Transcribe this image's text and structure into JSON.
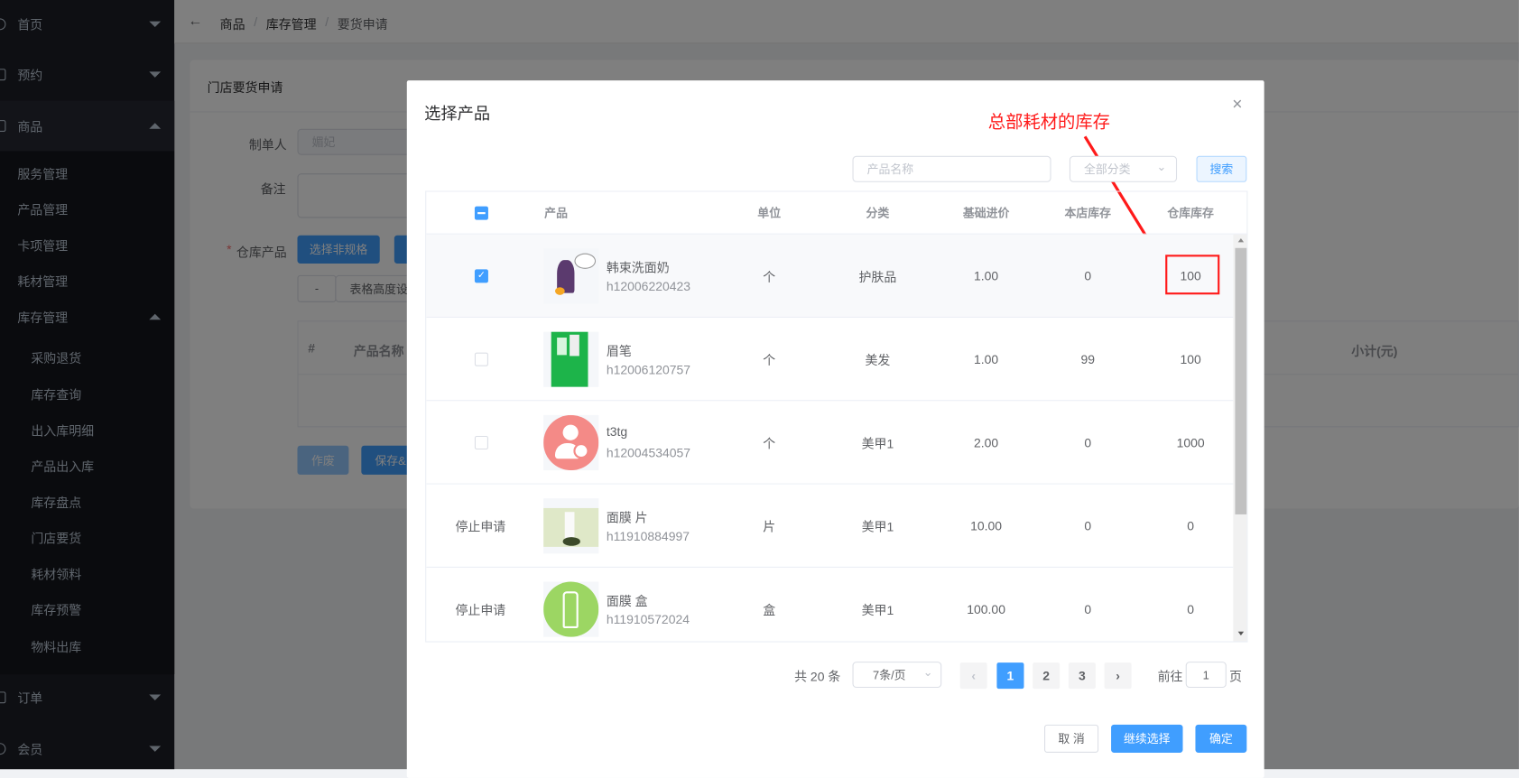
{
  "sidebar": {
    "items": [
      {
        "label": "首页"
      },
      {
        "label": "预约"
      },
      {
        "label": "商品"
      }
    ],
    "goods_sub": [
      "服务管理",
      "产品管理",
      "卡项管理",
      "耗材管理"
    ],
    "inventory": {
      "label": "库存管理",
      "sub": [
        "采购退货",
        "库存查询",
        "出入库明细",
        "产品出入库",
        "库存盘点",
        "门店要货",
        "耗材领料",
        "库存预警",
        "物料出库"
      ]
    },
    "bottom": [
      {
        "label": "订单"
      },
      {
        "label": "会员"
      }
    ]
  },
  "breadcrumb": {
    "back": "←",
    "items": [
      "商品",
      "库存管理",
      "要货申请"
    ],
    "sep": "/"
  },
  "form": {
    "card_title": "门店要货申请",
    "creator_label": "制单人",
    "creator_value": "媚妃",
    "remark_label": "备注",
    "product_label": "仓库产品",
    "required": "*",
    "select_nonspec": "选择非规格",
    "minus": "-",
    "table_height": "表格高度设",
    "table_headers": {
      "index": "#",
      "name": "产品名称",
      "subtotal": "小计(元)"
    },
    "void": "作废",
    "save": "保存&"
  },
  "modal": {
    "title": "选择产品",
    "close": "×",
    "annotation": "总部耗材的库存",
    "search_placeholder": "产品名称",
    "category_placeholder": "全部分类",
    "search_button": "搜索",
    "columns": {
      "product": "产品",
      "unit": "单位",
      "category": "分类",
      "price": "基础进价",
      "store_stock": "本店库存",
      "warehouse_stock": "仓库库存"
    },
    "rows": [
      {
        "state": "checked",
        "name": "韩束洗面奶",
        "code": "h12006220423",
        "unit": "个",
        "category": "护肤品",
        "price": "1.00",
        "store_stock": "0",
        "warehouse_stock": "100"
      },
      {
        "state": "unchecked",
        "name": "眉笔",
        "code": "h12006120757",
        "unit": "个",
        "category": "美发",
        "price": "1.00",
        "store_stock": "99",
        "warehouse_stock": "100"
      },
      {
        "state": "unchecked",
        "name": "t3tg",
        "code": "h12004534057",
        "unit": "个",
        "category": "美甲1",
        "price": "2.00",
        "store_stock": "0",
        "warehouse_stock": "1000"
      },
      {
        "state": "stopped",
        "stop_label": "停止申请",
        "name": "面膜 片",
        "code": "h11910884997",
        "unit": "片",
        "category": "美甲1",
        "price": "10.00",
        "store_stock": "0",
        "warehouse_stock": "0"
      },
      {
        "state": "stopped",
        "stop_label": "停止申请",
        "name": "面膜 盒",
        "code": "h11910572024",
        "unit": "盒",
        "category": "美甲1",
        "price": "100.00",
        "store_stock": "0",
        "warehouse_stock": "0"
      }
    ],
    "pagination": {
      "total": "共 20 条",
      "page_size": "7条/页",
      "pages": [
        "1",
        "2",
        "3"
      ],
      "current": "1",
      "goto_label": "前往",
      "goto_value": "1",
      "page_suffix": "页"
    },
    "footer": {
      "cancel": "取 消",
      "continue": "继续选择",
      "confirm": "确定"
    }
  },
  "colors": {
    "primary": "#409eff",
    "annotation": "#ff1a1a"
  }
}
